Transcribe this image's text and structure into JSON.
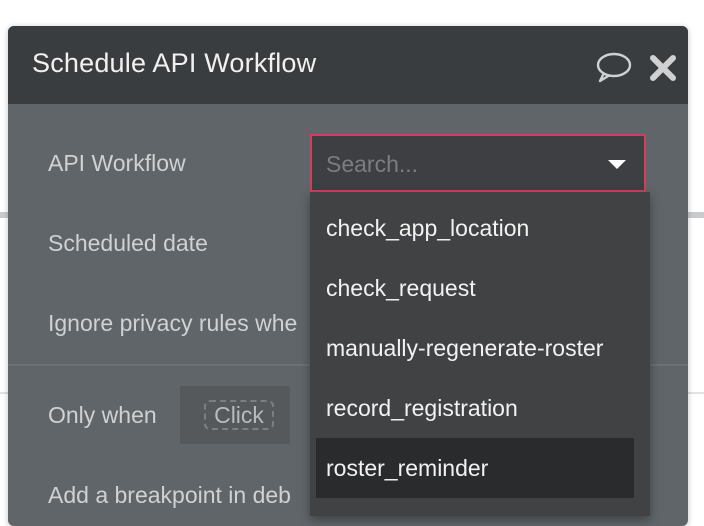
{
  "dialog": {
    "title": "Schedule API Workflow",
    "icons": {
      "comment": "speech-bubble-icon",
      "close": "close-icon"
    }
  },
  "fields": {
    "api_workflow_label": "API Workflow",
    "scheduled_date_label": "Scheduled date",
    "ignore_privacy_label": "Ignore privacy rules whe",
    "only_when_label": "Only when",
    "only_when_value": "Click",
    "breakpoint_label": "Add a breakpoint in deb"
  },
  "search": {
    "placeholder": "Search..."
  },
  "dropdown": {
    "items": [
      "check_app_location",
      "check_request",
      "manually-regenerate-roster",
      "record_registration",
      "roster_reminder"
    ],
    "highlighted": "roster_reminder"
  },
  "colors": {
    "panel_bg": "#5f6569",
    "header_bg": "#3a3d40",
    "dropdown_bg": "#414244",
    "selected_bg": "#2a2b2d",
    "accent_border": "#d23e5b"
  }
}
